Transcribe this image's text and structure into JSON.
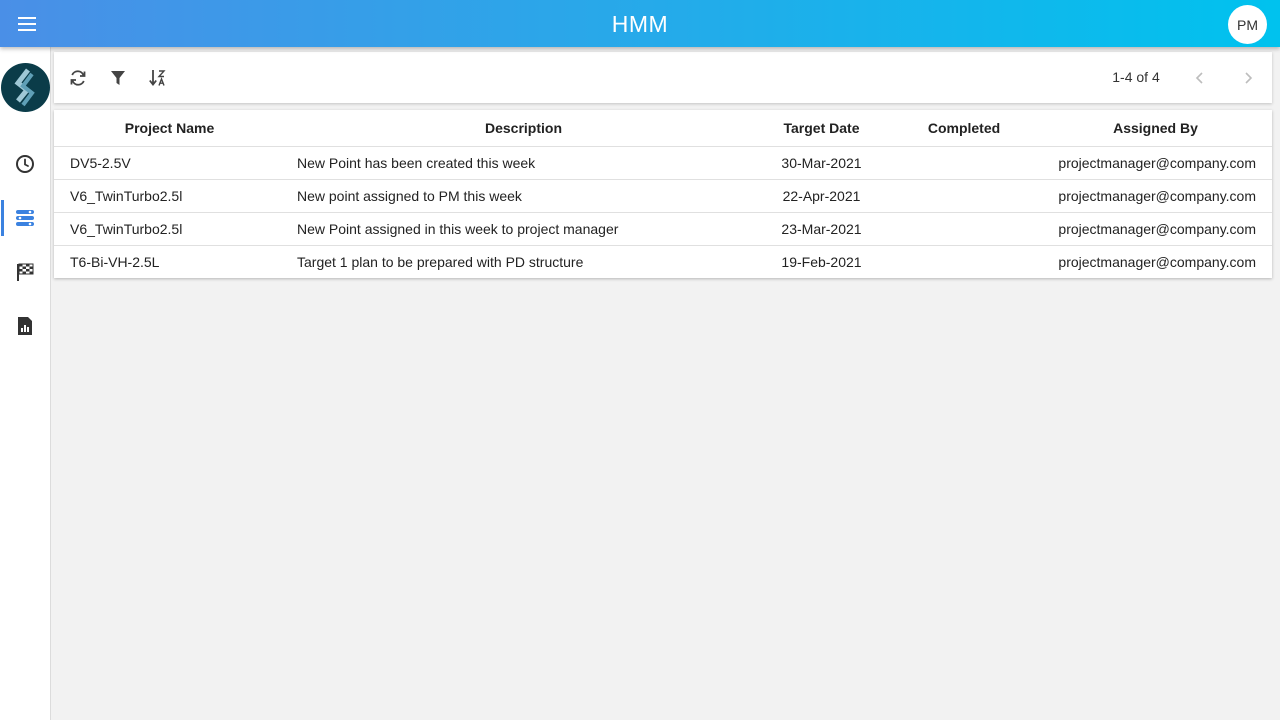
{
  "header": {
    "title": "HMM",
    "avatar_initials": "PM",
    "menu_icon": "hamburger-menu-icon"
  },
  "sidebar": {
    "items": [
      {
        "name": "clock",
        "icon": "clock-icon",
        "active": false
      },
      {
        "name": "tasks",
        "icon": "list-toggle-icon",
        "active": true
      },
      {
        "name": "milestones",
        "icon": "checkered-flag-icon",
        "active": false
      },
      {
        "name": "reports",
        "icon": "report-chart-icon",
        "active": false
      }
    ]
  },
  "toolbar": {
    "pagination_text": "1-4 of 4",
    "tools": [
      "refresh-icon",
      "filter-icon",
      "sort-az-icon"
    ]
  },
  "table": {
    "columns": [
      "Project Name",
      "Description",
      "Target Date",
      "Completed",
      "Assigned By"
    ],
    "rows": [
      {
        "project": "DV5-2.5V",
        "description": "New Point has been created this week",
        "target_date": "30-Mar-2021",
        "completed": "",
        "assigned_by": "projectmanager@company.com"
      },
      {
        "project": "V6_TwinTurbo2.5l",
        "description": "New point assigned to PM this week",
        "target_date": "22-Apr-2021",
        "completed": "",
        "assigned_by": "projectmanager@company.com"
      },
      {
        "project": "V6_TwinTurbo2.5l",
        "description": "New Point assigned in this week to project manager",
        "target_date": "23-Mar-2021",
        "completed": "",
        "assigned_by": "projectmanager@company.com"
      },
      {
        "project": "T6-Bi-VH-2.5L",
        "description": "Target 1 plan to be prepared with PD structure",
        "target_date": "19-Feb-2021",
        "completed": "",
        "assigned_by": "projectmanager@company.com"
      }
    ]
  },
  "colors": {
    "header_start": "#4a8fe7",
    "header_end": "#00c2ee",
    "accent": "#3b82e0",
    "background": "#f2f2f2"
  }
}
